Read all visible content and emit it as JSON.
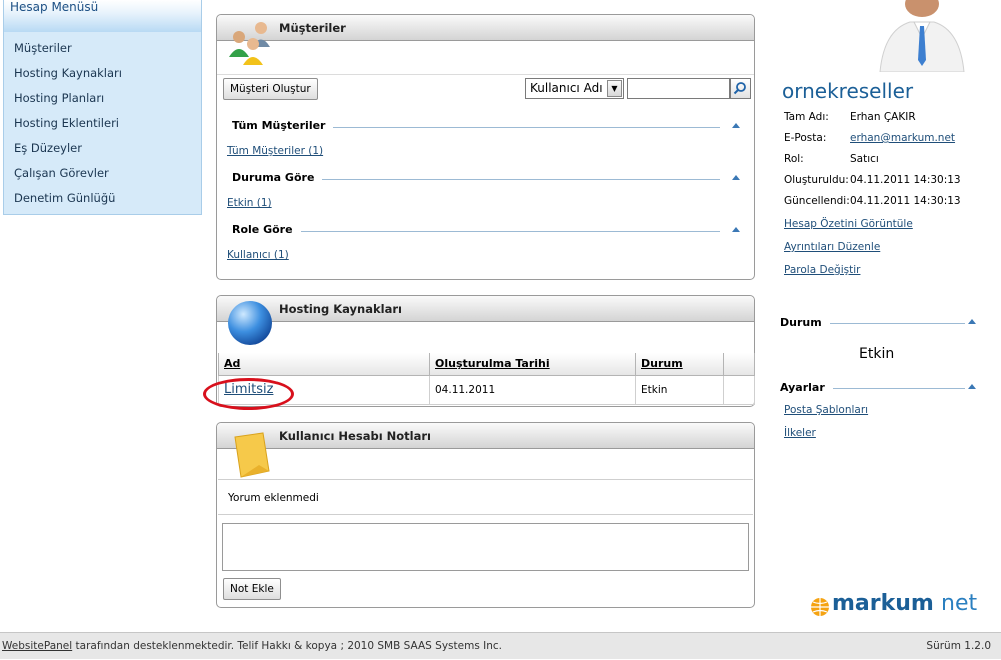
{
  "sidebar": {
    "title": "Hesap Menüsü",
    "items": [
      {
        "label": "Müşteriler"
      },
      {
        "label": "Hosting Kaynakları"
      },
      {
        "label": "Hosting Planları"
      },
      {
        "label": "Hosting Eklentileri"
      },
      {
        "label": "Eş Düzeyler"
      },
      {
        "label": "Çalışan Görevler"
      },
      {
        "label": "Denetim Günlüğü"
      }
    ]
  },
  "customers": {
    "title": "Müşteriler",
    "create_button": "Müşteri Oluştur",
    "search_field_select": "Kullanıcı Adı",
    "search_value": "",
    "groups": [
      {
        "title": "Tüm Müşteriler",
        "link": "Tüm Müşteriler (1)"
      },
      {
        "title": "Duruma Göre",
        "link": "Etkin (1)"
      },
      {
        "title": "Role Göre",
        "link": "Kullanıcı (1)"
      }
    ]
  },
  "hosting": {
    "title": "Hosting Kaynakları",
    "columns": [
      "Ad",
      "Oluşturulma Tarihi",
      "Durum",
      ""
    ],
    "rows": [
      {
        "name": "Limitsiz",
        "created": "04.11.2011",
        "status": "Etkin"
      }
    ]
  },
  "notes": {
    "title": "Kullanıcı Hesabı Notları",
    "empty_text": "Yorum eklenmedi",
    "textarea_value": "",
    "add_button": "Not Ekle"
  },
  "account": {
    "username": "ornekreseller",
    "fields": [
      {
        "label": "Tam Adı:",
        "value": "Erhan ÇAKIR"
      },
      {
        "label": "E-Posta:",
        "value": "erhan@markum.net"
      },
      {
        "label": "Rol:",
        "value": "Satıcı"
      },
      {
        "label": "Oluşturuldu:",
        "value": "04.11.2011 14:30:13"
      },
      {
        "label": "Güncellendi:",
        "value": "04.11.2011 14:30:13"
      }
    ],
    "links": [
      "Hesap Özetini Görüntüle",
      "Ayrıntıları Düzenle",
      "Parola Değiştir"
    ]
  },
  "status_section": {
    "title": "Durum",
    "value": "Etkin"
  },
  "settings_section": {
    "title": "Ayarlar",
    "links": [
      "Posta Şablonları",
      "İlkeler"
    ]
  },
  "footer": {
    "link": "WebsitePanel",
    "text": " tarafından desteklenmektedir. Telif Hakkı & kopya ; 2010 SMB SAAS Systems Inc.",
    "version": "Sürüm 1.2.0"
  },
  "logo": {
    "word1": "markum",
    "word2": "net"
  },
  "colors": {
    "accent": "#1b5f97",
    "highlight_ellipse": "#d8101c",
    "sidebar_bg": "#d6eaf9"
  }
}
